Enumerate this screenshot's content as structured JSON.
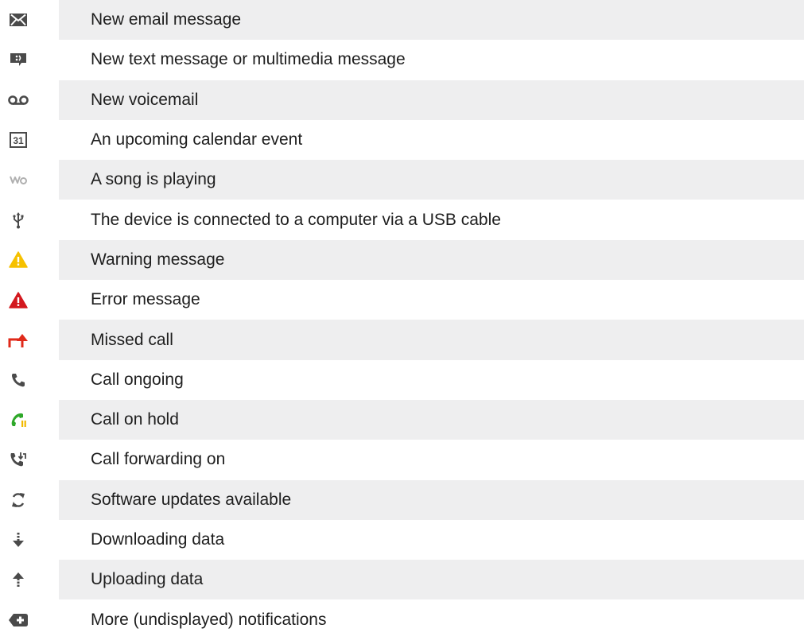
{
  "colors": {
    "row_shade": "#eeeeef",
    "text": "#1e1e1e",
    "icon_gray": "#4a4a4a",
    "warning_yellow": "#f6c100",
    "error_red": "#d3181e",
    "missed_call_red": "#e02a1a",
    "hold_green": "#2ea829",
    "hold_yellow": "#f2b900"
  },
  "rows": [
    {
      "icon": "email-icon",
      "text": "New email message"
    },
    {
      "icon": "text-message-icon",
      "text": "New text message or multimedia message"
    },
    {
      "icon": "voicemail-icon",
      "text": "New voicemail"
    },
    {
      "icon": "calendar-icon",
      "icon_text": "31",
      "text": "An upcoming calendar event"
    },
    {
      "icon": "walkman-icon",
      "text": "A song is playing"
    },
    {
      "icon": "usb-icon",
      "text": "The device is connected to a computer via a USB cable"
    },
    {
      "icon": "warning-icon",
      "text": "Warning message"
    },
    {
      "icon": "error-icon",
      "text": "Error message"
    },
    {
      "icon": "missed-call-icon",
      "text": "Missed call"
    },
    {
      "icon": "call-ongoing-icon",
      "text": "Call ongoing"
    },
    {
      "icon": "call-on-hold-icon",
      "text": "Call on hold"
    },
    {
      "icon": "call-forwarding-icon",
      "text": "Call forwarding on"
    },
    {
      "icon": "software-update-icon",
      "text": "Software updates available"
    },
    {
      "icon": "download-icon",
      "text": "Downloading data"
    },
    {
      "icon": "upload-icon",
      "text": "Uploading data"
    },
    {
      "icon": "more-notifications-icon",
      "text": "More (undisplayed) notifications"
    }
  ]
}
